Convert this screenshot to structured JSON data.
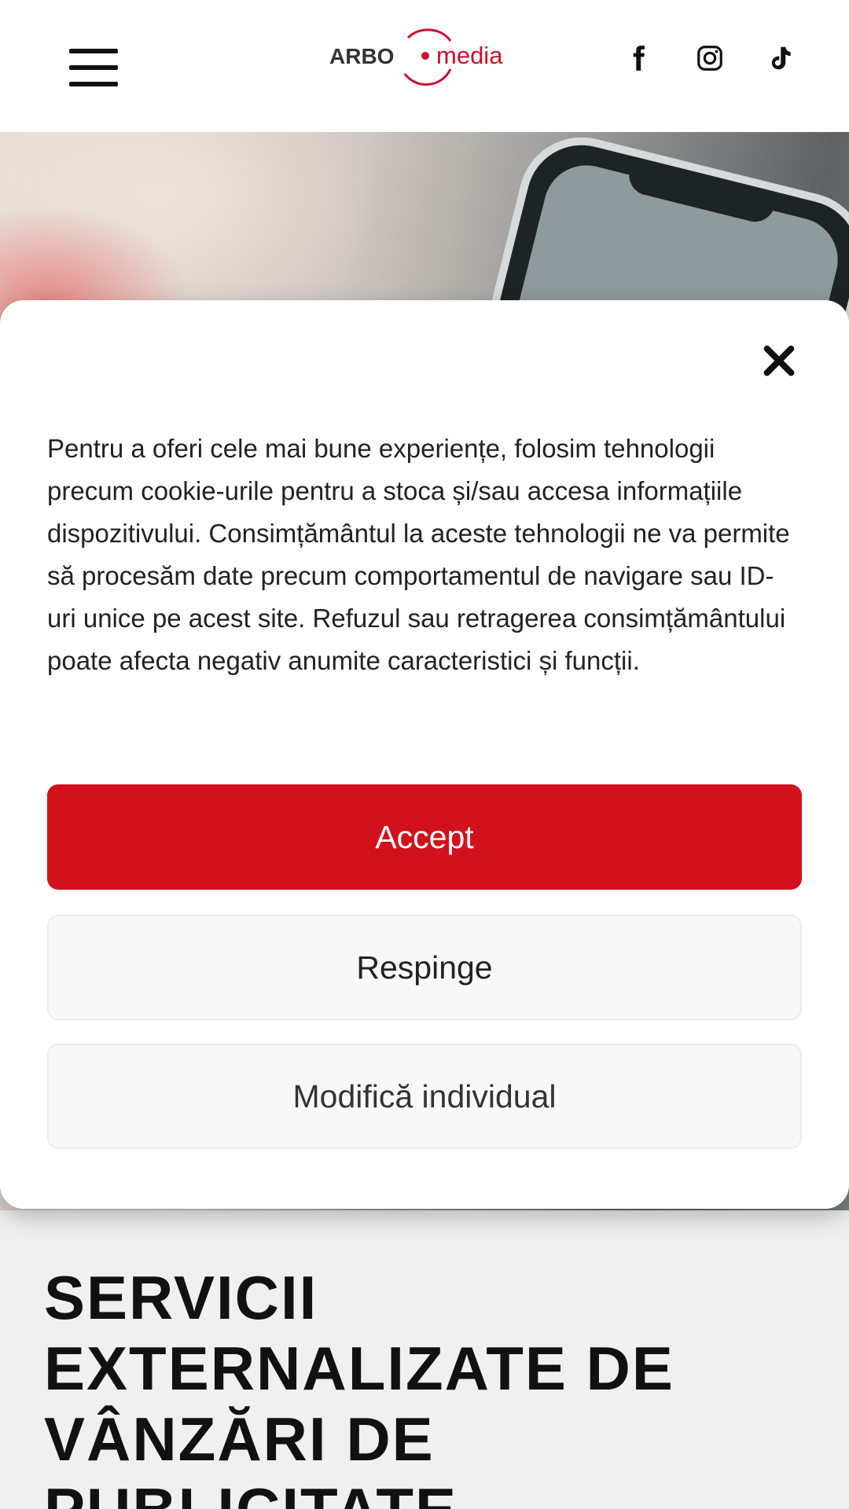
{
  "header": {
    "logo_text_left": "ARBO",
    "logo_text_right": "media",
    "menu_icon": "hamburger-menu-icon",
    "social": [
      {
        "name": "facebook-icon"
      },
      {
        "name": "instagram-icon"
      },
      {
        "name": "tiktok-icon"
      }
    ]
  },
  "cookie_banner": {
    "close_icon": "close-icon",
    "text": "Pentru a oferi cele mai bune experiențe, folosim tehnologii precum cookie-urile pentru a stoca și/sau accesa informațiile dispozitivului. Consimțământul la aceste tehnologii ne va permite să procesăm date precum comportamentul de navigare sau ID-uri unice pe acest site. Refuzul sau retragerea consimțământului poate afecta negativ anumite caracteristici și funcții.",
    "accept_label": "Accept",
    "deny_label": "Respinge",
    "modify_label": "Modifică individual"
  },
  "main": {
    "headline_lines": [
      "SERVICII",
      "EXTERNALIZATE DE",
      "VÂNZĂRI DE",
      "PUBLICITATE"
    ]
  },
  "colors": {
    "accent": "#d1121d",
    "logo_red": "#c8102e",
    "text_dark": "#111111"
  }
}
